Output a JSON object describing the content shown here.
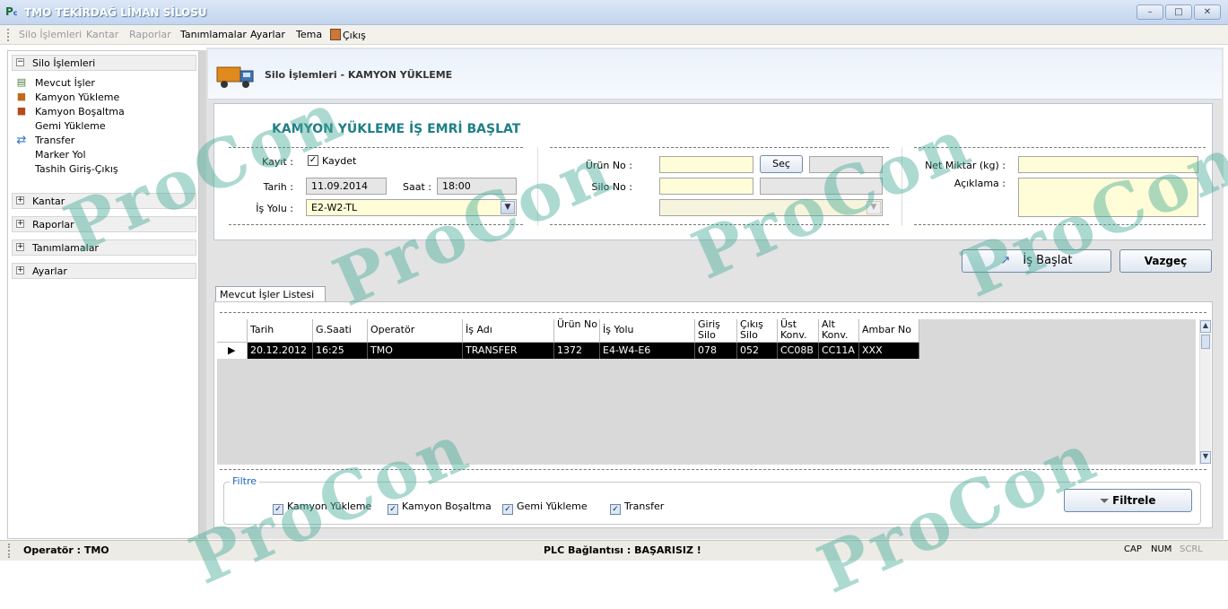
{
  "window": {
    "title": "TMO TEKİRDAĞ LİMAN SİLOSU",
    "min": "–",
    "max": "□",
    "close": "✕"
  },
  "menu": {
    "items": [
      "Silo İşlemleri",
      "Kantar",
      "Raporlar",
      "Tanımlamalar",
      "Ayarlar",
      "Tema",
      "Çıkış"
    ]
  },
  "sidebar": {
    "group_open": "Silo İşlemleri",
    "items": [
      "Mevcut İşler",
      "Kamyon Yükleme",
      "Kamyon Boşaltma",
      "Gemi Yükleme",
      "Transfer",
      "Marker Yol",
      "Tashih Giriş-Çıkış"
    ],
    "groups_collapsed": [
      "Kantar",
      "Raporlar",
      "Tanımlamalar",
      "Ayarlar"
    ]
  },
  "header": {
    "title": "Silo İşlemleri - KAMYON YÜKLEME"
  },
  "form": {
    "title": "KAMYON YÜKLEME İŞ EMRİ BAŞLAT",
    "kayit_label": "Kayıt :",
    "kaydet_label": "Kaydet",
    "kaydet_checked": true,
    "tarih_label": "Tarih :",
    "tarih_value": "11.09.2014",
    "saat_label": "Saat :",
    "saat_value": "18:00",
    "isyolu_label": "İş Yolu :",
    "isyolu_value": "E2-W2-TL",
    "urun_label": "Ürün No :",
    "urun_value": "",
    "sec_label": "Seç",
    "silo_label": "Silo No :",
    "silo_value": "",
    "net_label": "Net Miktar (kg) :",
    "net_value": "",
    "aciklama_label": "Açıklama :",
    "aciklama_value": ""
  },
  "actions": {
    "start": "İş Başlat",
    "cancel": "Vazgeç"
  },
  "list": {
    "tab": "Mevcut İşler Listesi",
    "columns": [
      "Tarih",
      "G.Saati",
      "Operatör",
      "İş Adı",
      "Ürün No",
      "İş Yolu",
      "Giriş Silo",
      "Çıkış Silo",
      "Üst Konv.",
      "Alt Konv.",
      "Ambar No"
    ],
    "row": [
      "20.12.2012",
      "16:25",
      "TMO",
      "TRANSFER",
      "1372",
      "E4-W4-E6",
      "078",
      "052",
      "CC08B",
      "CC11A",
      "XXX"
    ]
  },
  "filter": {
    "title": "Filtre",
    "options": [
      "Kamyon Yükleme",
      "Kamyon Boşaltma",
      "Gemi Yükleme",
      "Transfer"
    ],
    "button": "Filtrele"
  },
  "status": {
    "operator": "Operatör : TMO",
    "plc": "PLC Bağlantısı : BAŞARISIZ !",
    "keys": [
      "CAP",
      "NUM",
      "SCRL"
    ]
  },
  "watermark": "ProCon"
}
